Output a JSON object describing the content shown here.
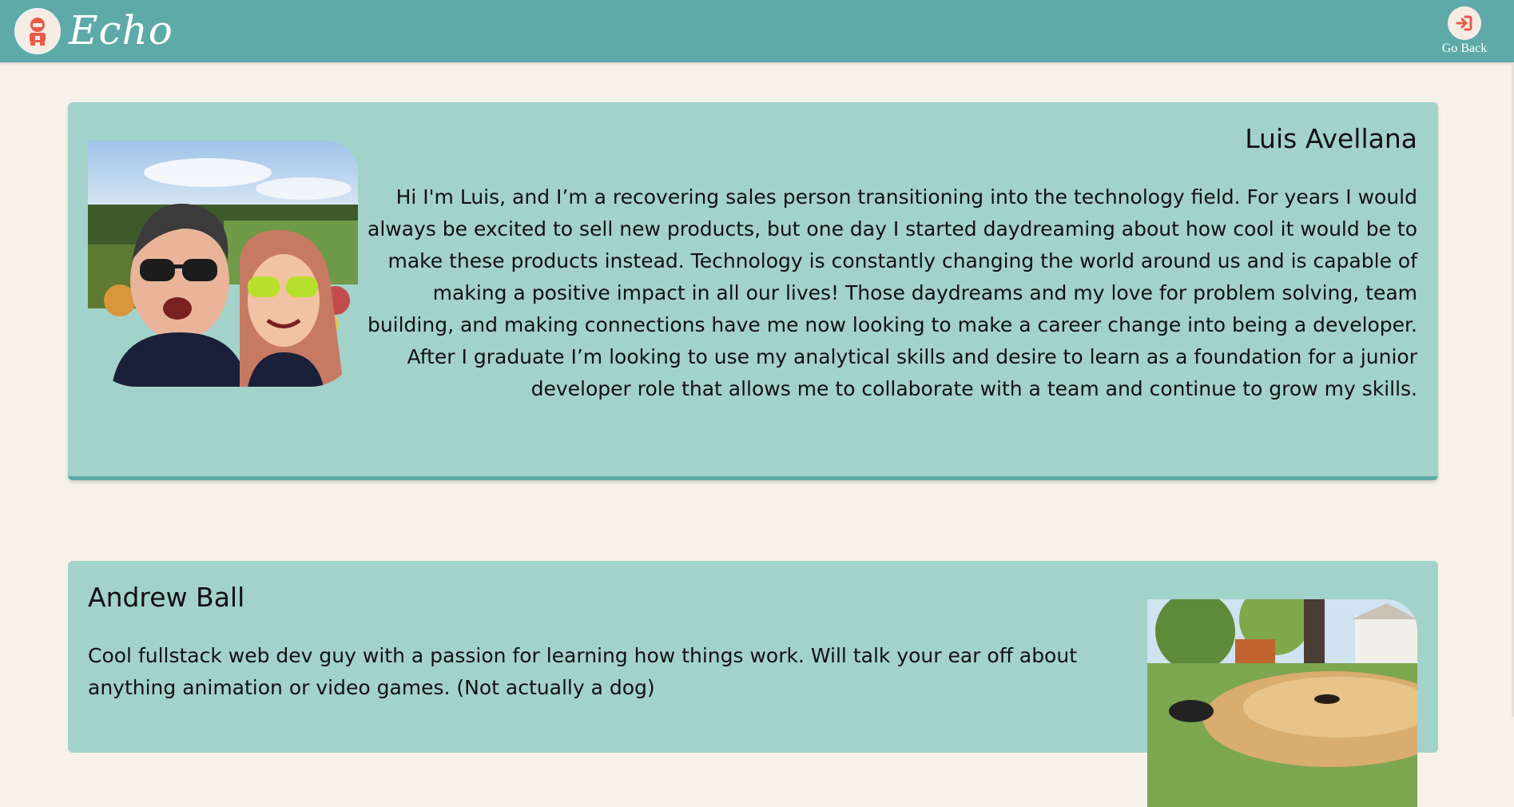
{
  "app": {
    "brand": "Echo",
    "go_back_label": "Go Back"
  },
  "icons": {
    "logo": "robot-mascot-icon",
    "go_back": "sign-in-arrow-icon"
  },
  "colors": {
    "header": "#5eaaa8",
    "card": "#a3d2ca",
    "page": "#f6f2e9",
    "accent": "#e8594a"
  },
  "profiles": [
    {
      "name": "Luis Avellana",
      "bio": "Hi I'm Luis, and I’m a recovering sales person transitioning into the technology field. For years I would always be excited to sell new products, but one day I started daydreaming about how cool it would be to make these products instead. Technology is constantly changing the world around us and is capable of making a positive impact in all our lives! Those daydreams and my love for problem solving, team building, and making connections have me now looking to make a career change into being a developer. After I graduate I’m looking to use my analytical skills and desire to learn as a foundation for a junior developer role that allows me to collaborate with a team and continue to grow my skills."
    },
    {
      "name": "Andrew Ball",
      "bio": "Cool fullstack web dev guy with a passion for learning how things work. Will talk your ear off about anything animation or video games. (Not actually a dog)"
    }
  ]
}
